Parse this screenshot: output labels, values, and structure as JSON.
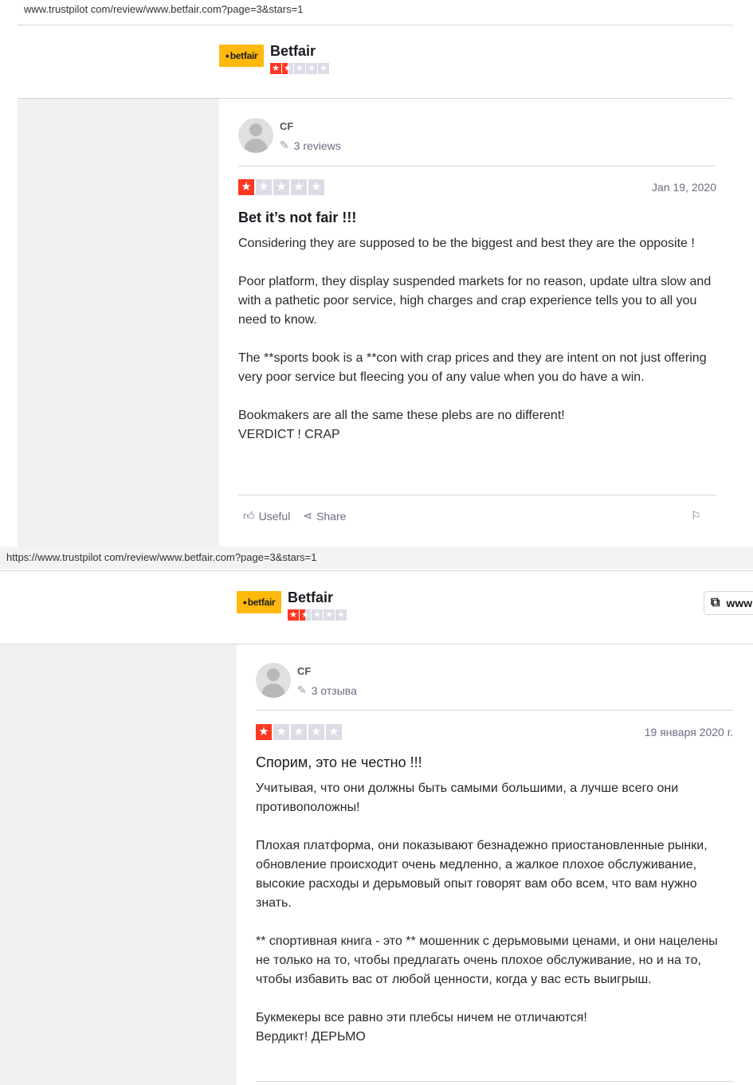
{
  "screenshot_en": {
    "url": "www.trustpilot com/review/www.betfair.com?page=3&stars=1",
    "company": {
      "logo_text": "betfair",
      "name": "Betfair",
      "rating_stars": 1.5
    },
    "review": {
      "author": "CF",
      "review_count": "3 reviews",
      "stars": 1,
      "date": "Jan 19, 2020",
      "title": "Bet it’s not fair !!!",
      "paragraphs": [
        "Considering they are supposed to be the biggest and best they are the opposite !",
        "Poor platform, they display suspended markets for no reason, update ultra slow and with a pathetic poor service, high charges and crap experience tells you to all you need to know.",
        "The **sports book is a **con with crap prices and they are intent on not just offering very poor service but fleecing you of any value when you do have a win.",
        "Bookmakers are all the same these plebs are no different!\nVERDICT ! CRAP"
      ],
      "useful_label": "Useful",
      "share_label": "Share"
    }
  },
  "screenshot_ru": {
    "url": "https://www.trustpilot com/review/www.betfair.com?page=3&stars=1",
    "company": {
      "logo_text": "betfair",
      "name": "Betfair",
      "rating_stars": 1.5
    },
    "visit_label": "www",
    "review": {
      "author": "CF",
      "review_count": "3 отзыва",
      "stars": 1,
      "date": "19 января 2020 г.",
      "title": "Спорим, это не честно !!!",
      "paragraphs": [
        "Учитывая, что они должны быть самыми большими, а лучше всего они противоположны!",
        "Плохая платформа, они показывают безнадежно приостановленные рынки, обновление происходит очень медленно, а жалкое плохое обслуживание, высокие расходы и дерьмовый опыт говорят вам обо всем, что вам нужно знать.",
        "** спортивная книга - это ** мошенник с дерьмовыми ценами, и они нацелены не только на то, чтобы предлагать очень плохое обслуживание, но и на то, чтобы избавить вас от любой ценности, когда у вас есть выигрыш.",
        "Букмекеры все равно эти плебсы ничем не отличаются!\nВердикт! ДЕРЬМО"
      ]
    }
  },
  "colors": {
    "star_red": "#ff3722",
    "star_grey": "#dcdce6",
    "logo_yellow": "#ffb80c",
    "side_bg": "#f0f0f2"
  },
  "icons": [
    "pencil-icon",
    "thumbs-up-icon",
    "share-icon",
    "flag-icon",
    "external-link-icon",
    "star-icon",
    "avatar-icon"
  ]
}
